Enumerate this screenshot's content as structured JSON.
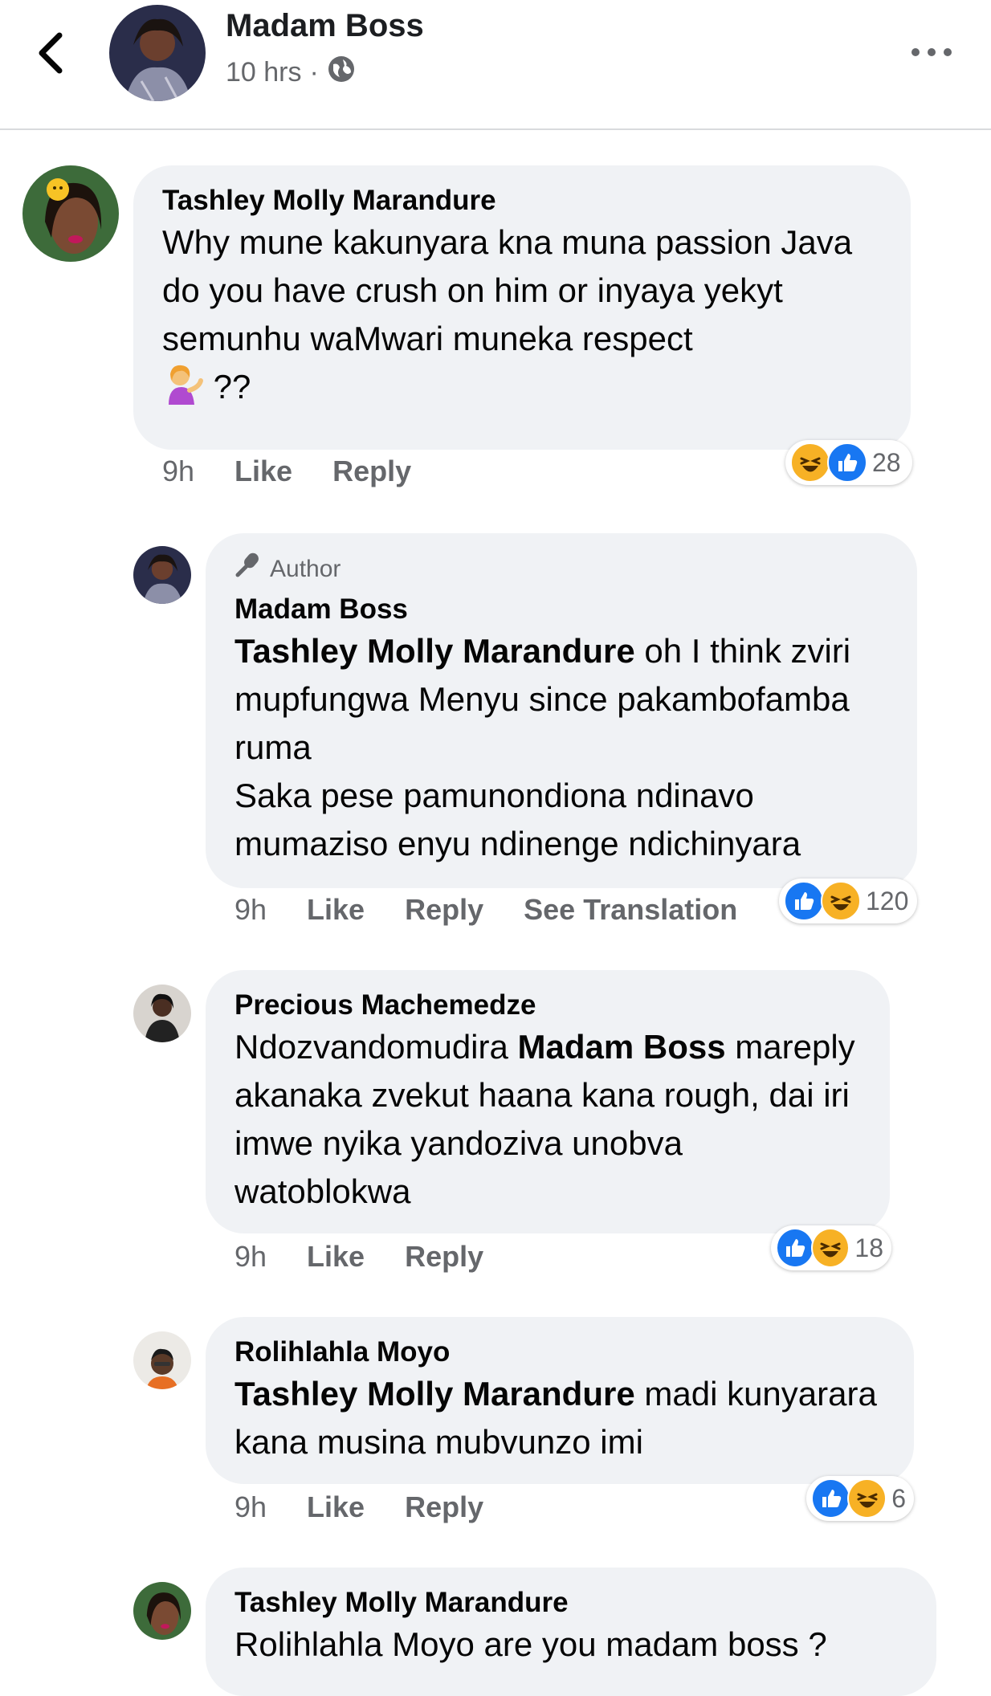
{
  "header": {
    "title": "Madam Boss",
    "time": "10 hrs",
    "separator": "·"
  },
  "comments": [
    {
      "name": "Tashley Molly Marandure",
      "text": "Why mune kakunyara kna muna passion Java do you have crush on him or inyaya yekyt semunhu waMwari muneka respect",
      "text_end": "??",
      "time": "9h",
      "like": "Like",
      "reply": "Reply",
      "reaction_count": "28"
    },
    {
      "author_badge": "Author",
      "name": "Madam Boss",
      "mention": "Tashley Molly Marandure",
      "text": " oh I think zviri mupfungwa Menyu since pakambofamba ruma",
      "text2": "Saka pese pamunondiona ndinavo mumaziso enyu ndinenge ndichinyara",
      "time": "9h",
      "like": "Like",
      "reply": "Reply",
      "translate": "See Translation",
      "reaction_count": "120"
    },
    {
      "name": "Precious Machemedze",
      "text_pre": "Ndozvandomudira ",
      "mention": "Madam Boss",
      "text": " mareply akanaka zvekut haana kana rough, dai iri imwe nyika yandoziva unobva watoblokwa",
      "time": "9h",
      "like": "Like",
      "reply": "Reply",
      "reaction_count": "18"
    },
    {
      "name": "Rolihlahla Moyo",
      "mention": "Tashley Molly Marandure",
      "text": " madi kunyarara kana musina mubvunzo imi",
      "time": "9h",
      "like": "Like",
      "reply": "Reply",
      "reaction_count": "6"
    },
    {
      "name": "Tashley Molly Marandure",
      "text": "Rolihlahla Moyo are you madam boss ?"
    }
  ],
  "colors": {
    "like": "#1877f2",
    "haha": "#f7b125",
    "bubble": "#f0f2f5",
    "meta": "#65676b"
  }
}
